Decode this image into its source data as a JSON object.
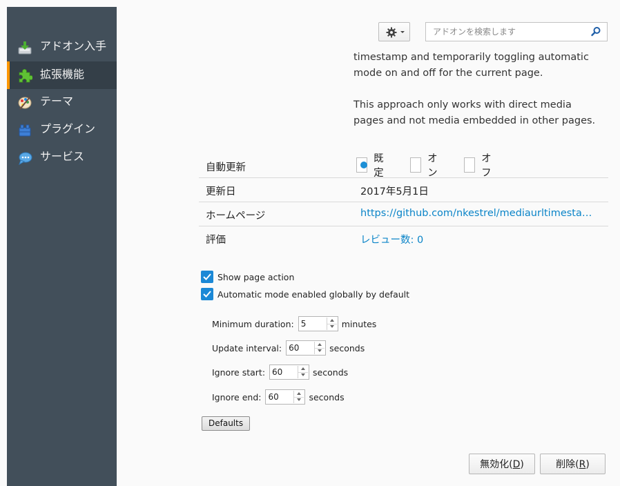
{
  "sidebar": {
    "items": [
      {
        "label": "アドオン入手",
        "icon": "get-addons-icon",
        "selected": false
      },
      {
        "label": "拡張機能",
        "icon": "puzzle-piece-icon",
        "selected": true
      },
      {
        "label": "テーマ",
        "icon": "palette-icon",
        "selected": false
      },
      {
        "label": "プラグイン",
        "icon": "plugin-brick-icon",
        "selected": false
      },
      {
        "label": "サービス",
        "icon": "chat-bubble-icon",
        "selected": false
      }
    ]
  },
  "toolbar": {
    "gear_icon": "gear-icon",
    "search_placeholder": "アドオンを検索します"
  },
  "description": {
    "paragraph1": "timestamp and temporarily toggling automatic mode on and off for the current page.",
    "paragraph2": "This approach only works with direct media pages and not media embedded in other pages."
  },
  "details": {
    "auto_update": {
      "label": "自動更新",
      "options": [
        "既定",
        "オン",
        "オフ"
      ],
      "selected": "既定"
    },
    "updated": {
      "label": "更新日",
      "value": "2017年5月1日"
    },
    "homepage": {
      "label": "ホームページ",
      "value": "https://github.com/nkestrel/mediaurltimesta…"
    },
    "rating": {
      "label": "評価",
      "value": "レビュー数: 0"
    }
  },
  "preferences": {
    "show_page_action": {
      "label": "Show page action",
      "checked": true
    },
    "auto_mode": {
      "label": "Automatic mode enabled globally by default",
      "checked": true
    },
    "min_duration": {
      "label": "Minimum duration:",
      "value": "5",
      "unit": "minutes"
    },
    "update_interval": {
      "label": "Update interval:",
      "value": "60",
      "unit": "seconds"
    },
    "ignore_start": {
      "label": "Ignore start:",
      "value": "60",
      "unit": "seconds"
    },
    "ignore_end": {
      "label": "Ignore end:",
      "value": "60",
      "unit": "seconds"
    },
    "defaults_label": "Defaults"
  },
  "actions": {
    "disable_label": "無効化",
    "disable_key": "D",
    "remove_label": "削除",
    "remove_key": "R"
  },
  "colors": {
    "sidebar_bg": "#424f5a",
    "selected_accent": "#ff9500",
    "link": "#0a84c8",
    "checkbox": "#1b88d6"
  }
}
